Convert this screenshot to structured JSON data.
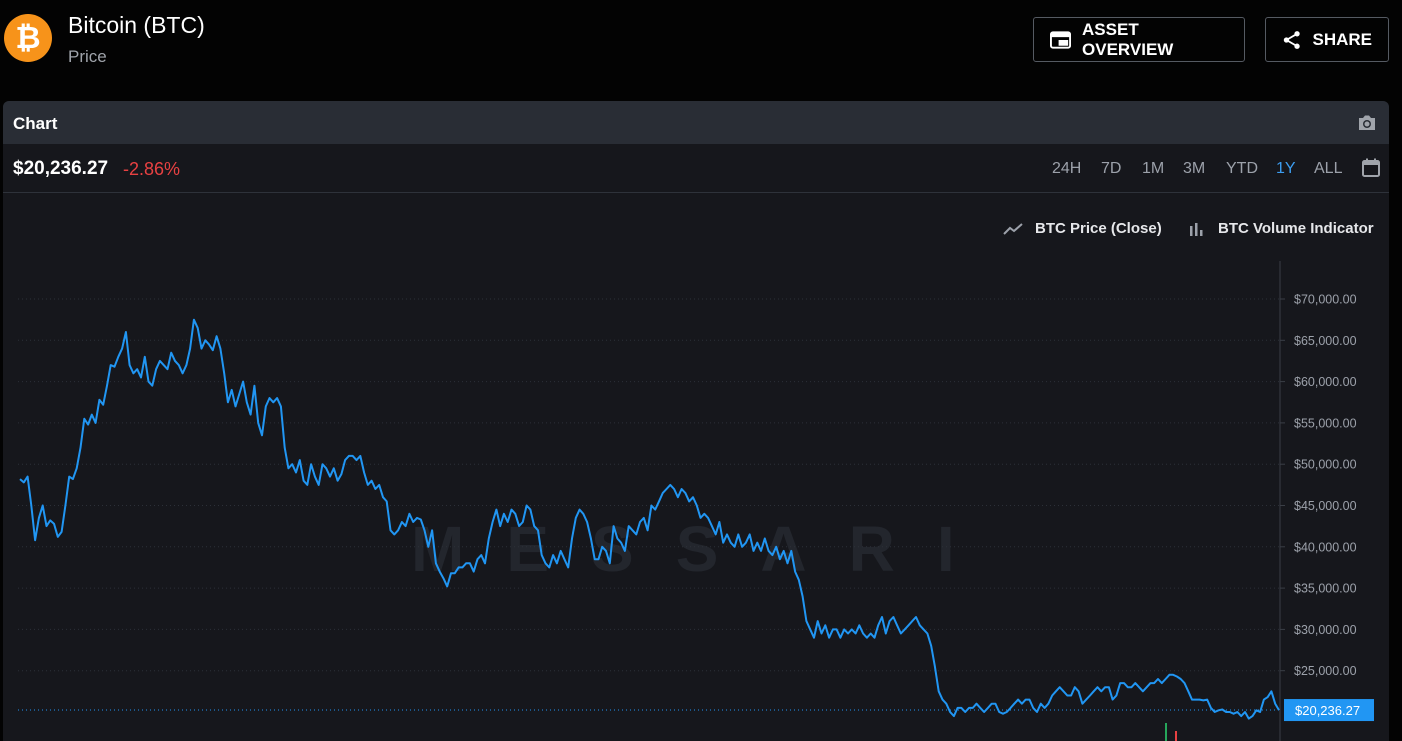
{
  "header": {
    "title": "Bitcoin (BTC)",
    "subtitle": "Price",
    "logo_symbol": "₿",
    "asset_overview_label": "ASSET OVERVIEW",
    "share_label": "SHARE"
  },
  "panel": {
    "title": "Chart",
    "current_price": "$20,236.27",
    "change": "-2.86%",
    "ranges": [
      {
        "label": "24H",
        "active": false
      },
      {
        "label": "7D",
        "active": false
      },
      {
        "label": "1M",
        "active": false
      },
      {
        "label": "3M",
        "active": false
      },
      {
        "label": "YTD",
        "active": false
      },
      {
        "label": "1Y",
        "active": true
      },
      {
        "label": "ALL",
        "active": false
      }
    ],
    "watermark": "MESSARI"
  },
  "colors": {
    "accent": "#3c9df0",
    "negative": "#e84142",
    "line": "#2196f3",
    "btc_orange": "#f7931a"
  },
  "icons": [
    "bitcoin-logo-icon",
    "asset-overview-icon",
    "share-icon",
    "camera-icon",
    "calendar-icon",
    "line-chart-icon",
    "bar-chart-icon"
  ],
  "chart_data": {
    "type": "line",
    "legend": [
      "BTC Price (Close)",
      "BTC Volume Indicator"
    ],
    "legend_placement": "top-right",
    "y_ticks": [
      "$70,000.00",
      "$65,000.00",
      "$60,000.00",
      "$55,000.00",
      "$50,000.00",
      "$45,000.00",
      "$40,000.00",
      "$35,000.00",
      "$30,000.00",
      "$25,000.00"
    ],
    "ylim": [
      20000,
      70000
    ],
    "last_value_label": "$20,236.27",
    "grid": true,
    "series": [
      {
        "name": "BTC Price (Close)",
        "values": [
          48200,
          47800,
          48500,
          45000,
          40800,
          43500,
          45000,
          42500,
          43200,
          42800,
          41200,
          41800,
          45000,
          48500,
          48200,
          49500,
          52000,
          55500,
          54800,
          56000,
          55000,
          57800,
          57200,
          59500,
          62000,
          61800,
          63000,
          64000,
          66000,
          62000,
          61000,
          61500,
          60500,
          63000,
          60000,
          59500,
          61500,
          62500,
          62000,
          61500,
          63500,
          62500,
          62000,
          61000,
          62000,
          64000,
          67500,
          66500,
          64000,
          65000,
          64500,
          63800,
          65500,
          64000,
          61000,
          57500,
          59000,
          57000,
          58500,
          60000,
          57500,
          56000,
          59500,
          55000,
          53500,
          57000,
          58000,
          57500,
          58000,
          57000,
          52000,
          49500,
          50000,
          49000,
          50500,
          48000,
          47500,
          50000,
          48500,
          47500,
          50000,
          49500,
          48500,
          49500,
          48000,
          48800,
          50500,
          51000,
          51000,
          50500,
          51000,
          49000,
          47500,
          48000,
          47000,
          47500,
          46000,
          45500,
          42000,
          41500,
          42000,
          43000,
          42500,
          44000,
          43000,
          43500,
          43300,
          42000,
          40000,
          42000,
          38000,
          37000,
          36200,
          35200,
          36800,
          36800,
          37500,
          37500,
          38000,
          38000,
          37000,
          38500,
          39000,
          38000,
          41000,
          43000,
          44500,
          42500,
          44000,
          43000,
          44500,
          44000,
          42500,
          43000,
          45000,
          44500,
          42500,
          42000,
          39000,
          38000,
          37500,
          39000,
          38000,
          39500,
          38500,
          37500,
          41000,
          43500,
          44500,
          44000,
          43000,
          41000,
          38500,
          38500,
          40000,
          39500,
          38000,
          42500,
          41000,
          40500,
          39500,
          42500,
          42000,
          41500,
          43000,
          43500,
          42000,
          45000,
          44500,
          45500,
          46500,
          47000,
          47500,
          47000,
          46000,
          47000,
          46500,
          45500,
          46000,
          45000,
          43500,
          44000,
          43500,
          42500,
          41500,
          43000,
          40500,
          41500,
          40500,
          40000,
          41500,
          40000,
          40500,
          41500,
          39500,
          40500,
          39500,
          41000,
          39500,
          39000,
          40000,
          38500,
          39500,
          38000,
          39500,
          37000,
          36000,
          34000,
          31000,
          30000,
          29000,
          31000,
          29500,
          30500,
          29000,
          30000,
          30000,
          29000,
          30000,
          29500,
          30000,
          29500,
          30500,
          29500,
          29000,
          29500,
          29000,
          30500,
          31500,
          29500,
          31000,
          31500,
          30500,
          29500,
          30000,
          30500,
          31000,
          31500,
          30500,
          30000,
          29500,
          28000,
          25500,
          22500,
          21500,
          21000,
          20000,
          19500,
          20500,
          20500,
          20000,
          20500,
          20500,
          21000,
          20500,
          20000,
          20500,
          21000,
          21000,
          20000,
          19800,
          20000,
          20500,
          21000,
          21500,
          21000,
          21500,
          21500,
          20500,
          20000,
          21000,
          20500,
          21000,
          22000,
          22500,
          23000,
          22500,
          22000,
          22000,
          23000,
          22500,
          21000,
          21500,
          22000,
          22500,
          23000,
          22500,
          23000,
          23000,
          21500,
          22000,
          23500,
          23500,
          23000,
          23000,
          23500,
          23000,
          22500,
          23000,
          23500,
          23500,
          24000,
          23500,
          24000,
          24500,
          24500,
          24300,
          24000,
          23500,
          22500,
          21500,
          21500,
          21500,
          21400,
          21500,
          20500,
          20000,
          20200,
          20300,
          20000,
          20000,
          19800,
          20000,
          19500,
          20000,
          19200,
          19500,
          20200,
          20000,
          21500,
          21800,
          22500,
          21000,
          20236
        ]
      }
    ]
  }
}
